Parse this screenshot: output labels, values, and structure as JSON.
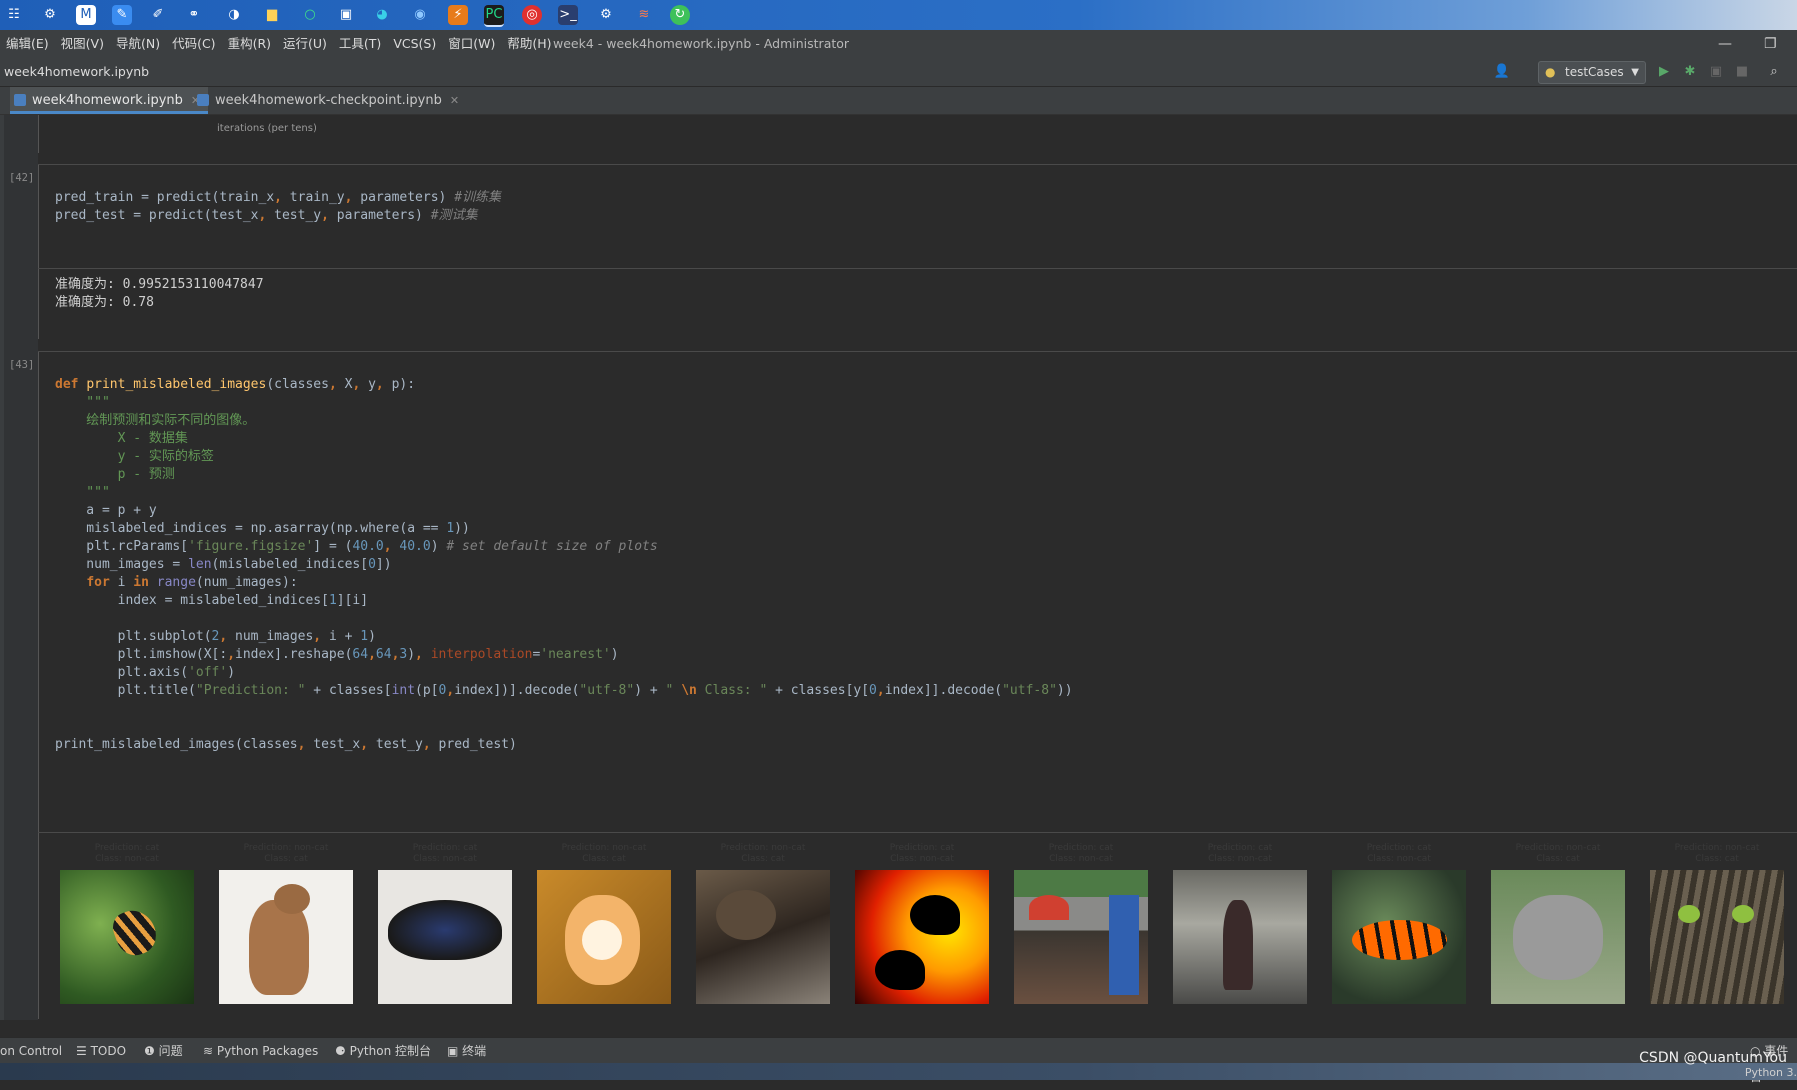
{
  "taskbar": {
    "icons": [
      "start-grid-icon",
      "settings-icon",
      "mail-icon",
      "notes-icon",
      "pen-icon",
      "share-icon",
      "browser-icon",
      "folder-icon",
      "search-icon",
      "store-icon",
      "edge-icon",
      "vpn-icon",
      "app-icon",
      "pycharm-icon",
      "netease-icon",
      "terminal-icon",
      "gear-app-icon",
      "spectrum-icon",
      "update-icon"
    ]
  },
  "menu": {
    "items": [
      "编辑(E)",
      "视图(V)",
      "导航(N)",
      "代码(C)",
      "重构(R)",
      "运行(U)",
      "工具(T)",
      "VCS(S)",
      "窗口(W)",
      "帮助(H)"
    ],
    "window_title": "week4 - week4homework.ipynb - Administrator"
  },
  "nav": {
    "breadcrumb": "week4homework.ipynb",
    "run_config": "testCases"
  },
  "tabs": [
    {
      "label": "week4homework.ipynb",
      "active": true
    },
    {
      "label": "week4homework-checkpoint.ipynb",
      "active": false
    }
  ],
  "plot_fragment": {
    "xlabel": "iterations (per tens)"
  },
  "cells": {
    "c42": {
      "exec_count": "[42]"
    },
    "c42_output": {
      "line1": "准确度为: 0.9952153110047847",
      "line2": "准确度为: 0.78"
    },
    "c43": {
      "exec_count": "[43]"
    }
  },
  "figure": {
    "panels": [
      {
        "title": "Prediction: cat\nClass: non-cat",
        "image": "butterfly-on-leaves"
      },
      {
        "title": "Prediction: non-cat\nClass: cat",
        "image": "sitting-brown-cat"
      },
      {
        "title": "Prediction: cat\nClass: non-cat",
        "image": "dark-butterfly"
      },
      {
        "title": "Prediction: non-cat\nClass: cat",
        "image": "orange-cat"
      },
      {
        "title": "Prediction: non-cat\nClass: cat",
        "image": "tabby-cats"
      },
      {
        "title": "Prediction: cat\nClass: non-cat",
        "image": "bird-silhouettes-sunset"
      },
      {
        "title": "Prediction: cat\nClass: non-cat",
        "image": "street-market"
      },
      {
        "title": "Prediction: cat\nClass: non-cat",
        "image": "street-people"
      },
      {
        "title": "Prediction: cat\nClass: non-cat",
        "image": "orange-butterfly"
      },
      {
        "title": "Prediction: non-cat\nClass: cat",
        "image": "grey-cat"
      },
      {
        "title": "Prediction: non-cat\nClass: cat",
        "image": "green-eyed-cat"
      }
    ]
  },
  "statusbar": {
    "items": [
      "on Control",
      "TODO",
      "问题",
      "Python Packages",
      "Python 控制台",
      "终端"
    ],
    "right": "事件日",
    "python_version": "Python 3.",
    "watermark": "CSDN @QuantumYou"
  },
  "colors": {
    "accent": "#4a88c7",
    "run_green": "#59a869",
    "editor_bg": "#2b2b2b"
  }
}
